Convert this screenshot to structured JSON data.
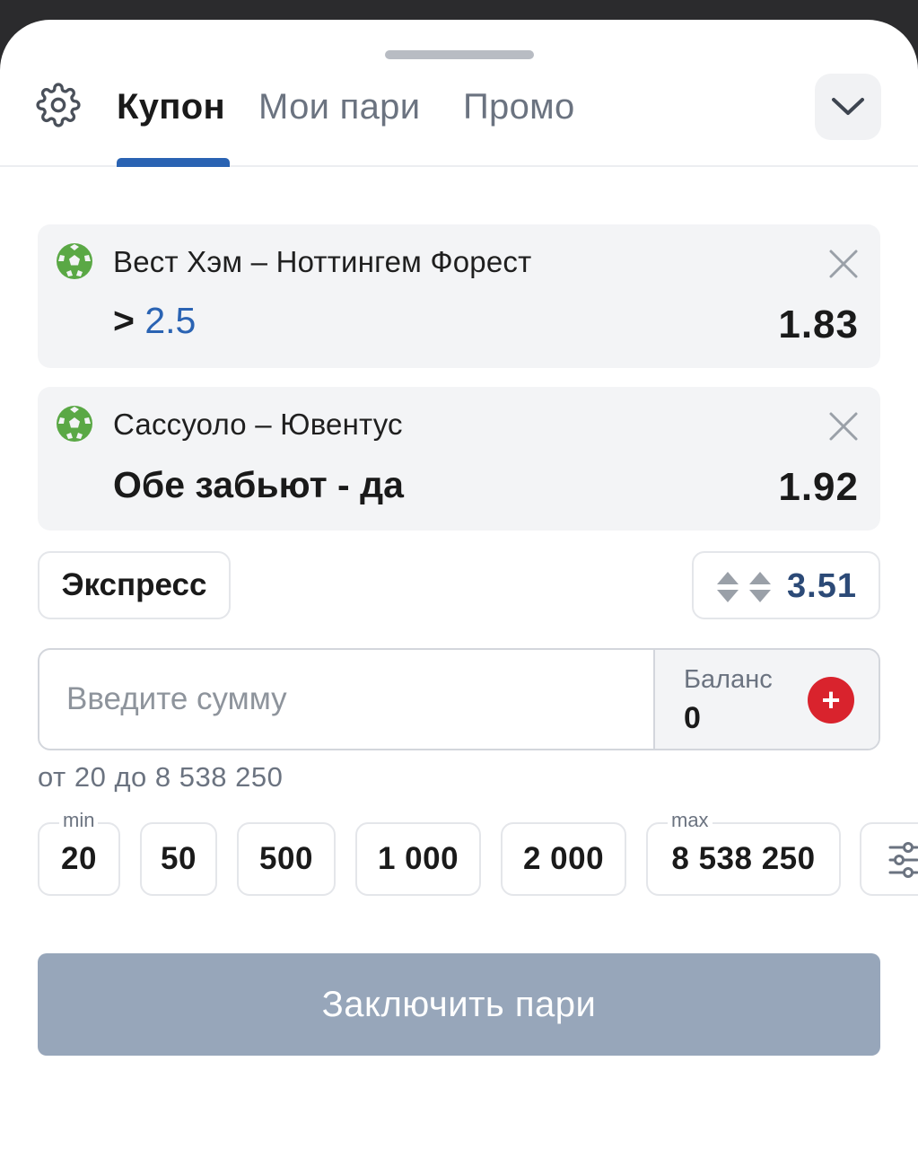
{
  "tabs": [
    {
      "label": "Купон",
      "active": true
    },
    {
      "label": "Мои пари",
      "active": false
    },
    {
      "label": "Промо",
      "active": false
    }
  ],
  "bets": [
    {
      "match": "Вест Хэм – Ноттингем Форест",
      "outcome_prefix": ">",
      "outcome_value": "2.5",
      "odds": "1.83",
      "icon": "soccer-ball-icon"
    },
    {
      "match": "Сассуоло – Ювентус",
      "outcome": "Обе забьют - да",
      "odds": "1.92",
      "icon": "soccer-ball-icon"
    }
  ],
  "bet_type": "Экспресс",
  "total_odds": "3.51",
  "amount": {
    "placeholder": "Введите сумму",
    "value": ""
  },
  "balance": {
    "label": "Баланс",
    "value": "0"
  },
  "range_text": "от 20 до 8 538 250",
  "chips": [
    {
      "value": "20",
      "tag": "min"
    },
    {
      "value": "50"
    },
    {
      "value": "500"
    },
    {
      "value": "1 000"
    },
    {
      "value": "2 000"
    },
    {
      "value": "8 538 250",
      "tag": "max"
    }
  ],
  "submit_label": "Заключить пари",
  "colors": {
    "accent": "#2a63b3",
    "plus": "#d9232d",
    "submit_disabled": "#97a6ba",
    "odds_blue": "#2c4a77"
  }
}
